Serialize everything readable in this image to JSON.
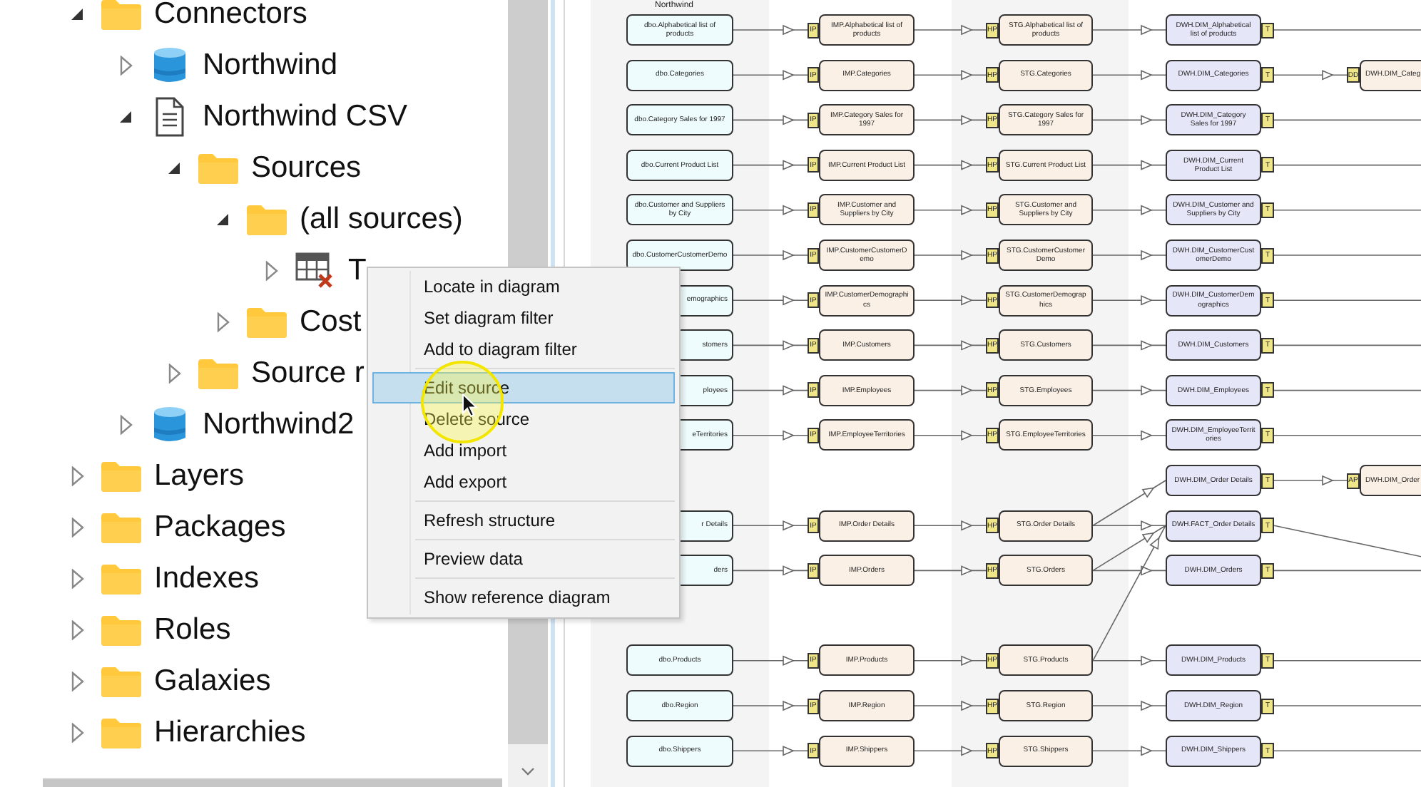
{
  "tree": {
    "items": [
      {
        "label": "Connectors",
        "kind": "folder",
        "expanded": true,
        "children": [
          {
            "label": "Northwind",
            "kind": "database",
            "expanded": false
          },
          {
            "label": "Northwind CSV",
            "kind": "document",
            "expanded": true,
            "children": [
              {
                "label": "Sources",
                "kind": "folder",
                "expanded": true,
                "children": [
                  {
                    "label": "(all sources)",
                    "kind": "folder",
                    "expanded": true,
                    "children": [
                      {
                        "label": "T",
                        "kind": "table",
                        "expanded": false
                      }
                    ]
                  },
                  {
                    "label": "Cost",
                    "kind": "folder",
                    "expanded": false
                  }
                ]
              },
              {
                "label": "Source r",
                "kind": "folder",
                "expanded": false
              }
            ]
          },
          {
            "label": "Northwind2",
            "kind": "database",
            "expanded": false
          }
        ]
      },
      {
        "label": "Layers",
        "kind": "folder",
        "expanded": false
      },
      {
        "label": "Packages",
        "kind": "folder",
        "expanded": false
      },
      {
        "label": "Indexes",
        "kind": "folder",
        "expanded": false
      },
      {
        "label": "Roles",
        "kind": "folder",
        "expanded": false
      },
      {
        "label": "Galaxies",
        "kind": "folder",
        "expanded": false
      },
      {
        "label": "Hierarchies",
        "kind": "folder",
        "expanded": false
      }
    ]
  },
  "context_menu": {
    "groups": [
      [
        {
          "label": "Locate in diagram",
          "selected": false
        },
        {
          "label": "Set diagram filter",
          "selected": false
        },
        {
          "label": "Add to diagram filter",
          "selected": false
        }
      ],
      [
        {
          "label": "Edit source",
          "selected": true
        },
        {
          "label": "Delete source",
          "selected": false
        },
        {
          "label": "Add import",
          "selected": false
        },
        {
          "label": "Add export",
          "selected": false
        }
      ],
      [
        {
          "label": "Refresh structure",
          "selected": false
        }
      ],
      [
        {
          "label": "Preview data",
          "selected": false
        }
      ],
      [
        {
          "label": "Show reference diagram",
          "selected": false
        }
      ]
    ]
  },
  "diagram": {
    "column_header": "Northwind",
    "row_groups": [
      [
        {
          "source": {
            "text": "dbo.Alphabetical list of products",
            "covered": false
          },
          "import": {
            "badge": "IP",
            "text": "IMP.Alphabetical list of products"
          },
          "staging": {
            "badge": "HP",
            "text": "STG.Alphabetical list of products"
          },
          "dwh": {
            "badge": "T",
            "text": "DWH.DIM_Alphabetical list of products"
          }
        },
        {
          "source": {
            "text": "dbo.Categories",
            "covered": false
          },
          "import": {
            "badge": "IP",
            "text": "IMP.Categories"
          },
          "staging": {
            "badge": "HP",
            "text": "STG.Categories"
          },
          "dwh": {
            "badge": "T",
            "text": "DWH.DIM_Categories"
          },
          "next": {
            "badge": "DD",
            "text": "DWH.DIM_Categ"
          }
        },
        {
          "source": {
            "text": "dbo.Category Sales for 1997",
            "covered": false
          },
          "import": {
            "badge": "IP",
            "text": "IMP.Category Sales for 1997"
          },
          "staging": {
            "badge": "HP",
            "text": "STG.Category Sales for 1997"
          },
          "dwh": {
            "badge": "T",
            "text": "DWH.DIM_Category Sales for 1997"
          }
        },
        {
          "source": {
            "text": "dbo.Current Product List",
            "covered": false
          },
          "import": {
            "badge": "IP",
            "text": "IMP.Current Product List"
          },
          "staging": {
            "badge": "HP",
            "text": "STG.Current Product List"
          },
          "dwh": {
            "badge": "T",
            "text": "DWH.DIM_Current Product List"
          }
        },
        {
          "source": {
            "text": "dbo.Customer and Suppliers by City",
            "covered": false
          },
          "import": {
            "badge": "IP",
            "text": "IMP.Customer and Suppliers by City"
          },
          "staging": {
            "badge": "HP",
            "text": "STG.Customer and Suppliers by City"
          },
          "dwh": {
            "badge": "T",
            "text": "DWH.DIM_Customer and Suppliers by City"
          }
        },
        {
          "source": {
            "text": "dbo.CustomerCustomerDemo",
            "covered": false
          },
          "import": {
            "badge": "IP",
            "text": "IMP.CustomerCustomerDemo"
          },
          "staging": {
            "badge": "HP",
            "text": "STG.CustomerCustomerDemo"
          },
          "dwh": {
            "badge": "T",
            "text": "DWH.DIM_CustomerCustomerDemo"
          }
        },
        {
          "source": {
            "text": "emographics",
            "covered": true
          },
          "import": {
            "badge": "IP",
            "text": "IMP.CustomerDemographics"
          },
          "staging": {
            "badge": "HP",
            "text": "STG.CustomerDemographics"
          },
          "dwh": {
            "badge": "T",
            "text": "DWH.DIM_CustomerDemographics"
          }
        },
        {
          "source": {
            "text": "stomers",
            "covered": true
          },
          "import": {
            "badge": "IP",
            "text": "IMP.Customers"
          },
          "staging": {
            "badge": "HP",
            "text": "STG.Customers"
          },
          "dwh": {
            "badge": "T",
            "text": "DWH.DIM_Customers"
          }
        },
        {
          "source": {
            "text": "ployees",
            "covered": true
          },
          "import": {
            "badge": "IP",
            "text": "IMP.Employees"
          },
          "staging": {
            "badge": "HP",
            "text": "STG.Employees"
          },
          "dwh": {
            "badge": "T",
            "text": "DWH.DIM_Employees"
          }
        },
        {
          "source": {
            "text": "eTerritories",
            "covered": true
          },
          "import": {
            "badge": "IP",
            "text": "IMP.EmployeeTerritories"
          },
          "staging": {
            "badge": "HP",
            "text": "STG.EmployeeTerritories"
          },
          "dwh": {
            "badge": "T",
            "text": "DWH.DIM_EmployeeTerritories"
          }
        },
        {
          "dwh": {
            "badge": "T",
            "text": "DWH.DIM_Order Details"
          },
          "next": {
            "badge": "AP",
            "text": "DWH.DIM_Order"
          }
        },
        {
          "source": {
            "text": "r Details",
            "covered": true
          },
          "import": {
            "badge": "IP",
            "text": "IMP.Order Details"
          },
          "staging": {
            "badge": "HP",
            "text": "STG.Order Details"
          },
          "dwh": {
            "badge": "T",
            "text": "DWH.FACT_Order Details"
          }
        },
        {
          "source": {
            "text": "ders",
            "covered": true
          },
          "import": {
            "badge": "IP",
            "text": "IMP.Orders"
          },
          "staging": {
            "badge": "HP",
            "text": "STG.Orders"
          },
          "dwh": {
            "badge": "T",
            "text": "DWH.DIM_Orders"
          }
        }
      ],
      [
        {
          "source": {
            "text": "dbo.Products",
            "covered": false
          },
          "import": {
            "badge": "IP",
            "text": "IMP.Products"
          },
          "staging": {
            "badge": "HP",
            "text": "STG.Products"
          },
          "dwh": {
            "badge": "T",
            "text": "DWH.DIM_Products"
          }
        },
        {
          "source": {
            "text": "dbo.Region",
            "covered": false
          },
          "import": {
            "badge": "IP",
            "text": "IMP.Region"
          },
          "staging": {
            "badge": "HP",
            "text": "STG.Region"
          },
          "dwh": {
            "badge": "T",
            "text": "DWH.DIM_Region"
          }
        },
        {
          "source": {
            "text": "dbo.Shippers",
            "covered": false
          },
          "import": {
            "badge": "IP",
            "text": "IMP.Shippers"
          },
          "staging": {
            "badge": "HP",
            "text": "STG.Shippers"
          },
          "dwh": {
            "badge": "T",
            "text": "DWH.DIM_Shippers"
          }
        }
      ]
    ]
  }
}
